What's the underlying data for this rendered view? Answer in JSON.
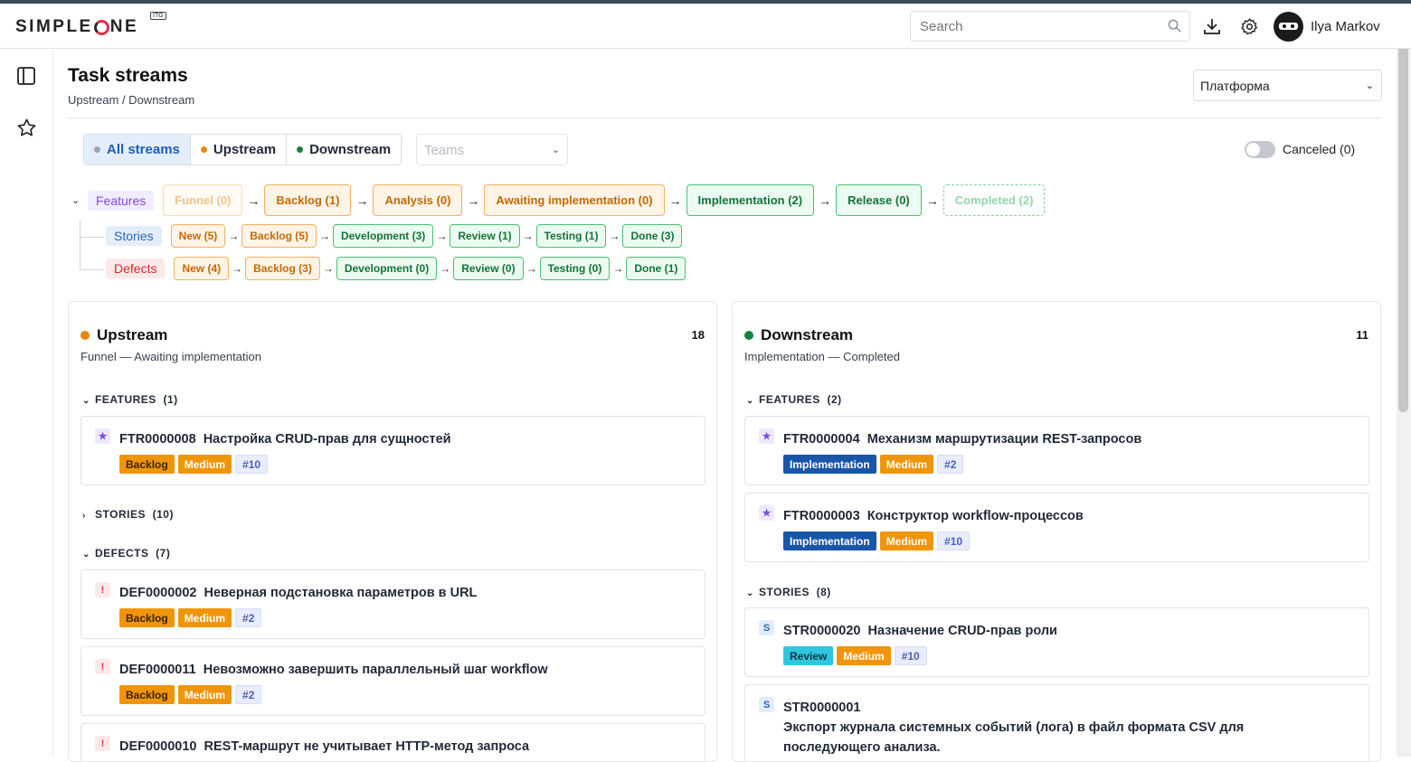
{
  "app": {
    "logo_text_1": "SIMPLE",
    "logo_text_2": "NE",
    "logo_badge": "ITG",
    "user_name": "Ilya Markov"
  },
  "search": {
    "placeholder": "Search"
  },
  "page": {
    "title": "Task streams",
    "breadcrumb": "Upstream / Downstream",
    "platform_select": "Платформа"
  },
  "filters": {
    "segments": [
      {
        "label": "All streams",
        "color": "#9ca3af"
      },
      {
        "label": "Upstream",
        "color": "#e8870a"
      },
      {
        "label": "Downstream",
        "color": "#16833f"
      }
    ],
    "teams_placeholder": "Teams",
    "canceled_label": "Canceled (0)"
  },
  "workflow": {
    "features": {
      "label": "Features",
      "steps": [
        {
          "label": "Funnel (0)",
          "style": "orange-f"
        },
        {
          "label": "Backlog (1)",
          "style": "orange"
        },
        {
          "label": "Analysis (0)",
          "style": "orange"
        },
        {
          "label": "Awaiting implementation (0)",
          "style": "orange"
        },
        {
          "label": "Implementation (2)",
          "style": "green"
        },
        {
          "label": "Release (0)",
          "style": "green"
        },
        {
          "label": "Completed (2)",
          "style": "green-f"
        }
      ]
    },
    "stories": {
      "label": "Stories",
      "steps": [
        {
          "label": "New (5)",
          "style": "orange"
        },
        {
          "label": "Backlog (5)",
          "style": "orange"
        },
        {
          "label": "Development (3)",
          "style": "green"
        },
        {
          "label": "Review (1)",
          "style": "green"
        },
        {
          "label": "Testing (1)",
          "style": "green"
        },
        {
          "label": "Done (3)",
          "style": "green"
        }
      ]
    },
    "defects": {
      "label": "Defects",
      "steps": [
        {
          "label": "New (4)",
          "style": "orange"
        },
        {
          "label": "Backlog (3)",
          "style": "orange"
        },
        {
          "label": "Development (0)",
          "style": "green"
        },
        {
          "label": "Review (0)",
          "style": "green"
        },
        {
          "label": "Testing (0)",
          "style": "green"
        },
        {
          "label": "Done (1)",
          "style": "green"
        }
      ]
    }
  },
  "upstream": {
    "title": "Upstream",
    "count": "18",
    "subtitle": "Funnel — Awaiting implementation",
    "features_header": "FEATURES  (1)",
    "stories_header": "STORIES  (10)",
    "defects_header": "DEFECTS  (7)",
    "features": [
      {
        "id": "FTR0000008",
        "title": "Настройка CRUD-прав для сущностей",
        "tags": [
          "Backlog",
          "Medium",
          "#10"
        ]
      }
    ],
    "defects": [
      {
        "id": "DEF0000002",
        "title": "Неверная подстановка параметров в URL",
        "tags": [
          "Backlog",
          "Medium",
          "#2"
        ]
      },
      {
        "id": "DEF0000011",
        "title": "Невозможно завершить параллельный шаг workflow",
        "tags": [
          "Backlog",
          "Medium",
          "#2"
        ]
      },
      {
        "id": "DEF0000010",
        "title": "REST-маршрут не учитывает HTTP-метод запроса",
        "tags": []
      }
    ]
  },
  "downstream": {
    "title": "Downstream",
    "count": "11",
    "subtitle": "Implementation — Completed",
    "features_header": "FEATURES  (2)",
    "stories_header": "STORIES  (8)",
    "features": [
      {
        "id": "FTR0000004",
        "title": "Механизм маршрутизации REST-запросов",
        "tags": [
          "Implementation",
          "Medium",
          "#2"
        ]
      },
      {
        "id": "FTR0000003",
        "title": "Конструктор workflow-процессов",
        "tags": [
          "Implementation",
          "Medium",
          "#10"
        ]
      }
    ],
    "stories": [
      {
        "id": "STR0000020",
        "title": "Назначение CRUD-прав роли",
        "tags": [
          "Review",
          "Medium",
          "#10"
        ]
      },
      {
        "id": "STR0000001",
        "title": "Экспорт журнала системных событий (лога) в файл формата CSV для последующего анализа.",
        "tags": []
      }
    ]
  }
}
